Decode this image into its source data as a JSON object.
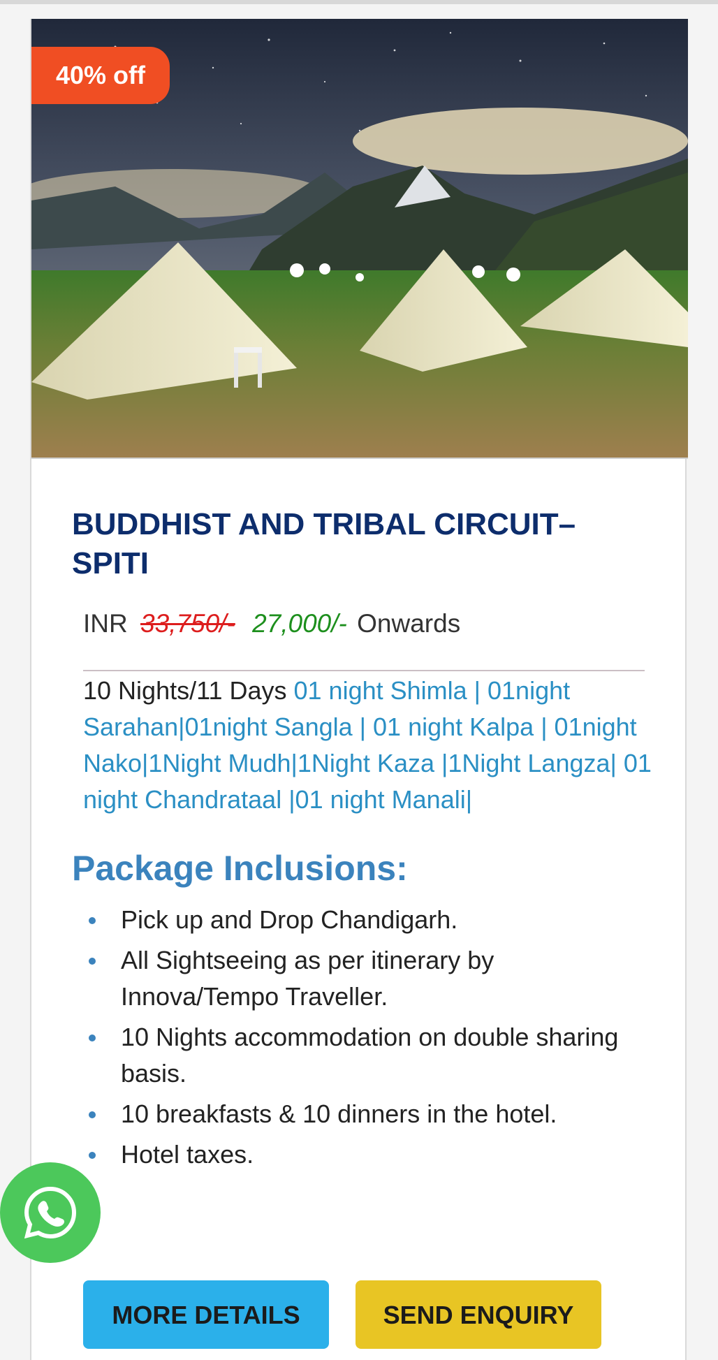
{
  "card": {
    "discount_badge": "40% off",
    "title": "BUDDHIST AND TRIBAL CIRCUIT– SPITI",
    "price": {
      "currency": "INR",
      "original": "33,750/-",
      "discounted": "27,000/-",
      "suffix": "Onwards"
    },
    "duration": "10 Nights/11 Days",
    "route": "01 night Shimla | 01night Sarahan|01night Sangla | 01 night Kalpa | 01night Nako|1Night Mudh|1Night Kaza |1Night Langza| 01 night Chandrataal |01 night Manali|",
    "inclusions_heading": "Package Inclusions:",
    "inclusions": [
      "Pick up and Drop Chandigarh.",
      "All Sightseeing as per itinerary by Innova/Tempo Traveller.",
      "10 Nights accommodation on double sharing basis.",
      "10 breakfasts & 10 dinners in the hotel.",
      "Hotel taxes."
    ],
    "buttons": {
      "more_details": "MORE DETAILS",
      "send_enquiry": "SEND ENQUIRY"
    }
  },
  "floating": {
    "whatsapp_icon": "whatsapp-icon"
  },
  "colors": {
    "badge": "#f04e23",
    "title": "#0d2d6c",
    "route_link": "#2a8fc4",
    "heading": "#3b83bd",
    "more_details_button": "#2bb0ea",
    "send_enquiry_button": "#e8c524",
    "whatsapp": "#4cc85b"
  }
}
